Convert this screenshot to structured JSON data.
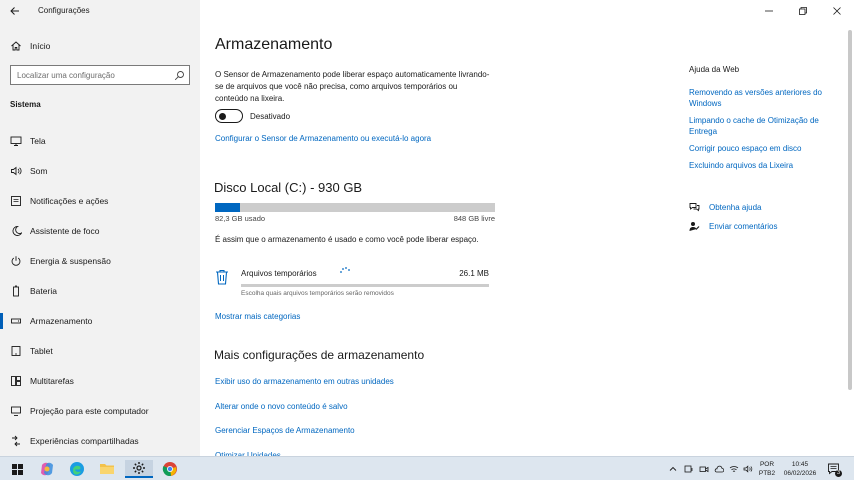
{
  "window": {
    "title": "Configurações"
  },
  "sidebar": {
    "home_label": "Início",
    "search_placeholder": "Localizar uma configuração",
    "section_label": "Sistema",
    "items": [
      {
        "label": "Tela",
        "icon": "monitor-icon"
      },
      {
        "label": "Som",
        "icon": "speaker-icon"
      },
      {
        "label": "Notificações e ações",
        "icon": "notification-icon"
      },
      {
        "label": "Assistente de foco",
        "icon": "moon-icon"
      },
      {
        "label": "Energia & suspensão",
        "icon": "power-icon"
      },
      {
        "label": "Bateria",
        "icon": "battery-icon"
      },
      {
        "label": "Armazenamento",
        "icon": "storage-icon",
        "active": true
      },
      {
        "label": "Tablet",
        "icon": "tablet-icon"
      },
      {
        "label": "Multitarefas",
        "icon": "multitask-icon"
      },
      {
        "label": "Projeção para este computador",
        "icon": "projection-icon"
      },
      {
        "label": "Experiências compartilhadas",
        "icon": "share-icon"
      }
    ]
  },
  "main": {
    "title": "Armazenamento",
    "description": "O Sensor de Armazenamento pode liberar espaço automaticamente livrando-se de arquivos que você não precisa, como arquivos temporários ou conteúdo na lixeira.",
    "toggle_label": "Desativado",
    "toggle_on": false,
    "configure_link": "Configurar o Sensor de Armazenamento ou executá-lo agora",
    "disk": {
      "title": "Disco Local (C:) - 930 GB",
      "used_label": "82,3 GB usado",
      "free_label": "848 GB livre",
      "used_fraction": 0.088
    },
    "usage_description": "É assim que o armazenamento é usado e como você pode liberar espaço.",
    "temp_files": {
      "name": "Arquivos temporários",
      "size": "26.1 MB",
      "subtitle": "Escolha quais arquivos temporários serão removidos",
      "fraction": 0.0
    },
    "show_more_link": "Mostrar mais categorias",
    "more_title": "Mais configurações de armazenamento",
    "more_links": [
      "Exibir uso do armazenamento em outras unidades",
      "Alterar onde o novo conteúdo é salvo",
      "Gerenciar Espaços de Armazenamento",
      "Otimizar Unidades"
    ]
  },
  "help": {
    "title": "Ajuda da Web",
    "links": [
      "Removendo as versões anteriores do Windows",
      "Limpando o cache de Otimização de Entrega",
      "Corrigir pouco espaço em disco",
      "Excluindo arquivos da Lixeira"
    ],
    "get_help": "Obtenha ajuda",
    "feedback": "Enviar comentários"
  },
  "taskbar": {
    "language_line1": "POR",
    "language_line2": "PTB2",
    "time": "10:45",
    "date": "06/02/2026",
    "notification_count": "3"
  },
  "colors": {
    "accent": "#0067c0",
    "sidebar_bg": "#f2f2f2",
    "taskbar_bg": "#dde6ef"
  }
}
